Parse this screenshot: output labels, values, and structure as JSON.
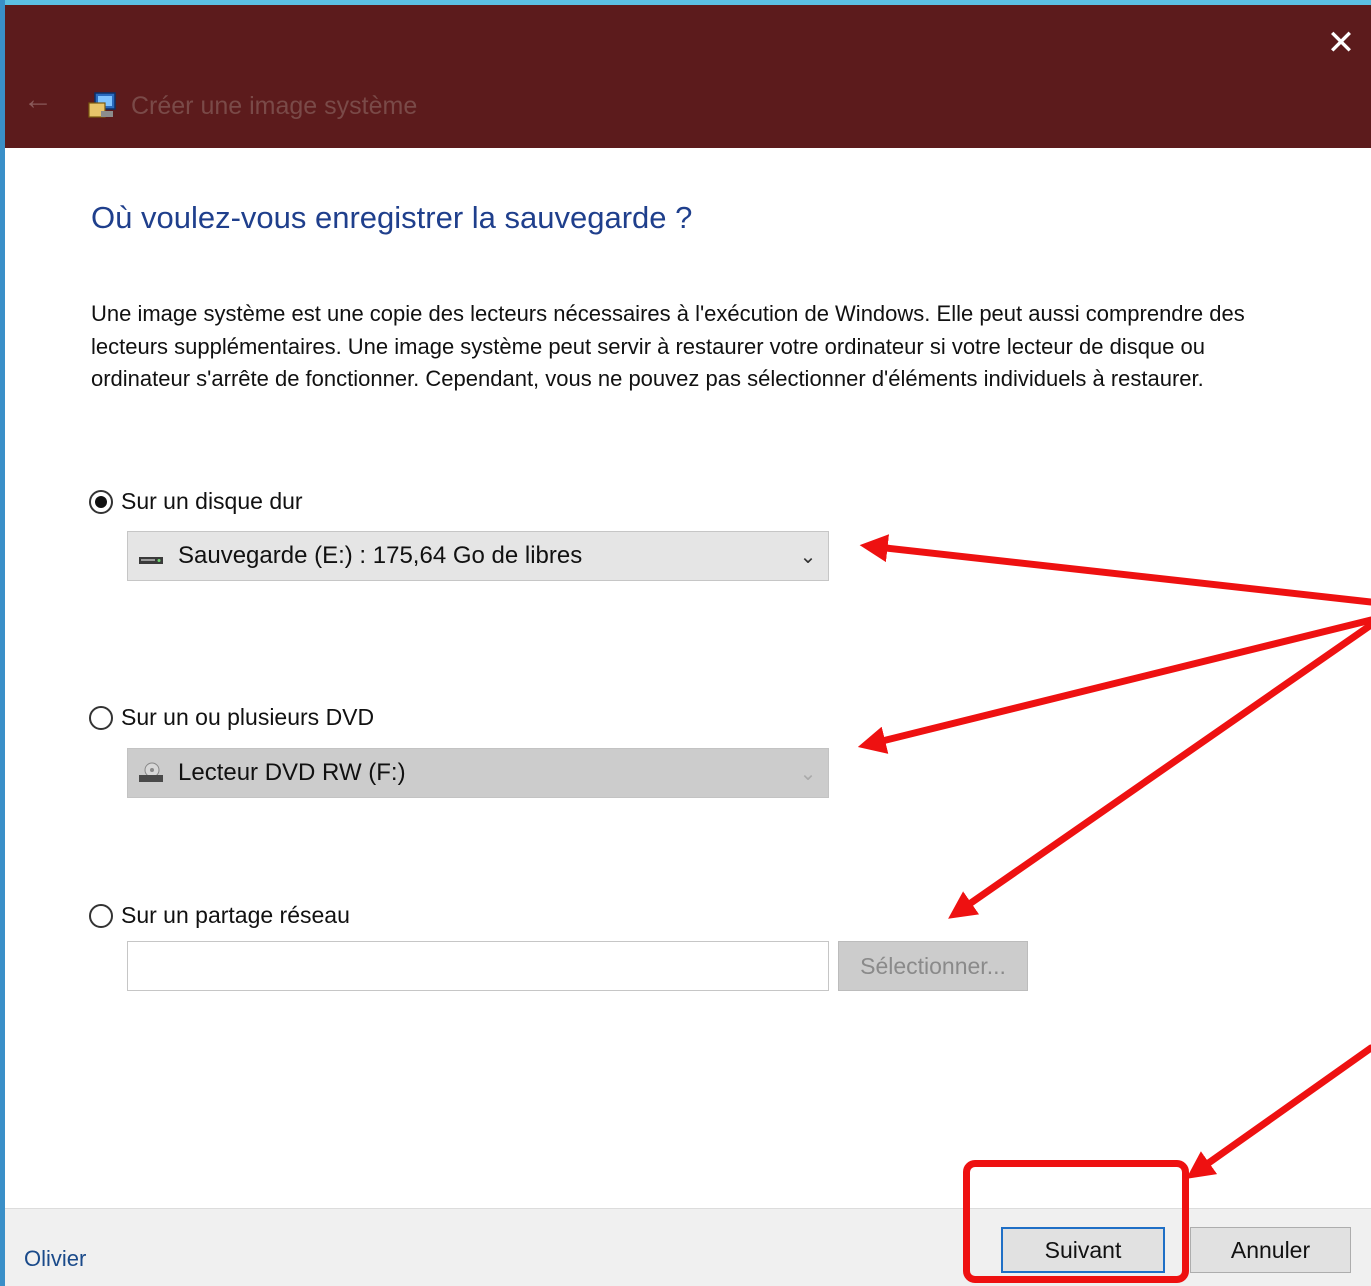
{
  "window": {
    "title": "Créer une image système",
    "close_glyph": "✕",
    "back_glyph": "←",
    "accent": "#5c1b1c"
  },
  "page": {
    "heading": "Où voulez-vous enregistrer la sauvegarde ?",
    "description": "Une image système est une copie des lecteurs nécessaires à l'exécution de Windows. Elle peut aussi comprendre des lecteurs supplémentaires. Une image système peut servir à restaurer votre ordinateur si votre lecteur de disque ou ordinateur s'arrête de fonctionner. Cependant, vous ne pouvez pas sélectionner d'éléments individuels à restaurer."
  },
  "options": {
    "hard_disk": {
      "label": "Sur un disque dur",
      "checked": true,
      "selected_value": "Sauvegarde (E:) : 175,64 Go de libres",
      "icon": "hard-drive-icon"
    },
    "dvd": {
      "label": "Sur un ou plusieurs DVD",
      "checked": false,
      "selected_value": "Lecteur DVD RW (F:)",
      "icon": "dvd-drive-icon"
    },
    "network": {
      "label": "Sur un partage réseau",
      "checked": false,
      "input_value": "",
      "button_label": "Sélectionner..."
    }
  },
  "footer": {
    "next_label": "Suivant",
    "cancel_label": "Annuler"
  },
  "annotation": {
    "watermark": "Olivier",
    "arrow_color": "#ee1111"
  }
}
